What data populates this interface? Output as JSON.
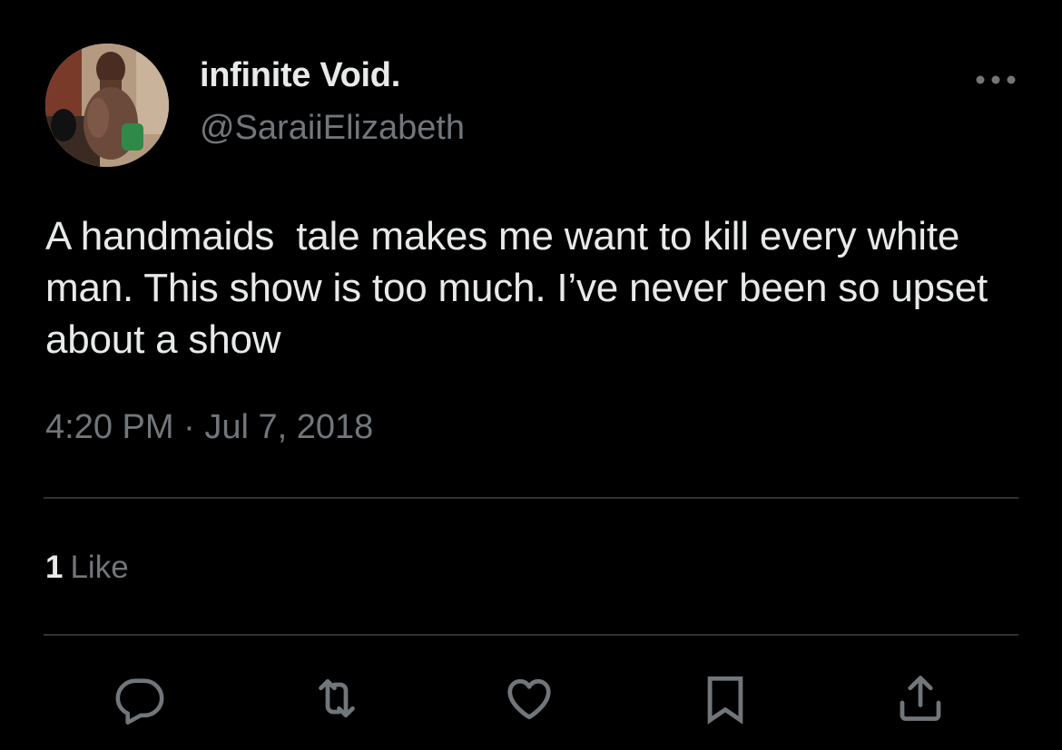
{
  "tweet": {
    "display_name": "infinite Void.",
    "handle": "@SaraiiElizabeth",
    "text": "A handmaids  tale makes me want to kill every white man. This show is too much. I’ve never been so upset about a show",
    "time": "4:20 PM",
    "separator": "·",
    "date": "Jul 7, 2018"
  },
  "stats": {
    "likes_count": "1",
    "likes_label": "Like"
  },
  "icons": {
    "more": "more-horizontal-icon",
    "reply": "reply-icon",
    "retweet": "retweet-icon",
    "like": "heart-icon",
    "bookmark": "bookmark-icon",
    "share": "share-icon"
  },
  "colors": {
    "background": "#000000",
    "primary_text": "#e7e9ea",
    "secondary_text": "#71767b",
    "divider": "#2f3336"
  }
}
